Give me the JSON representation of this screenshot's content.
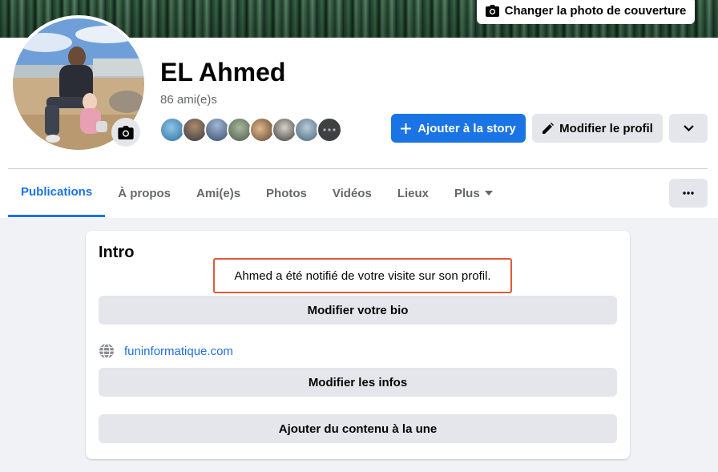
{
  "cover": {
    "change_cover_label": "Changer la photo de couverture"
  },
  "profile": {
    "name": "EL Ahmed",
    "friends_count": "86 ami(e)s",
    "friend_faces": [
      "face-1",
      "face-2",
      "face-3",
      "face-4",
      "face-5",
      "face-6",
      "face-7",
      "face-8"
    ]
  },
  "actions": {
    "add_story_label": "Ajouter à la story",
    "edit_profile_label": "Modifier le profil"
  },
  "tabs": [
    {
      "label": "Publications",
      "active": true
    },
    {
      "label": "À propos"
    },
    {
      "label": "Ami(e)s"
    },
    {
      "label": "Photos"
    },
    {
      "label": "Vidéos"
    },
    {
      "label": "Lieux"
    },
    {
      "label": "Plus",
      "dropdown": true
    }
  ],
  "intro": {
    "title": "Intro",
    "notice": "Ahmed a été notifié de votre visite sur son profil.",
    "edit_bio_label": "Modifier votre bio",
    "website": "funinformatique.com",
    "edit_info_label": "Modifier les infos",
    "add_featured_label": "Ajouter du contenu à la une"
  },
  "icons": {
    "camera": "camera-icon",
    "plus": "plus-icon",
    "pencil": "pencil-icon",
    "chevron": "chevron-down-icon",
    "more": "more-dots-icon",
    "globe": "globe-icon",
    "caret": "caret-down-icon"
  },
  "colors": {
    "accent": "#1b74e4",
    "button_gray": "#e4e6eb",
    "page_bg": "#f0f2f5",
    "notice_border": "#e05a3a",
    "link": "#216fdb"
  }
}
